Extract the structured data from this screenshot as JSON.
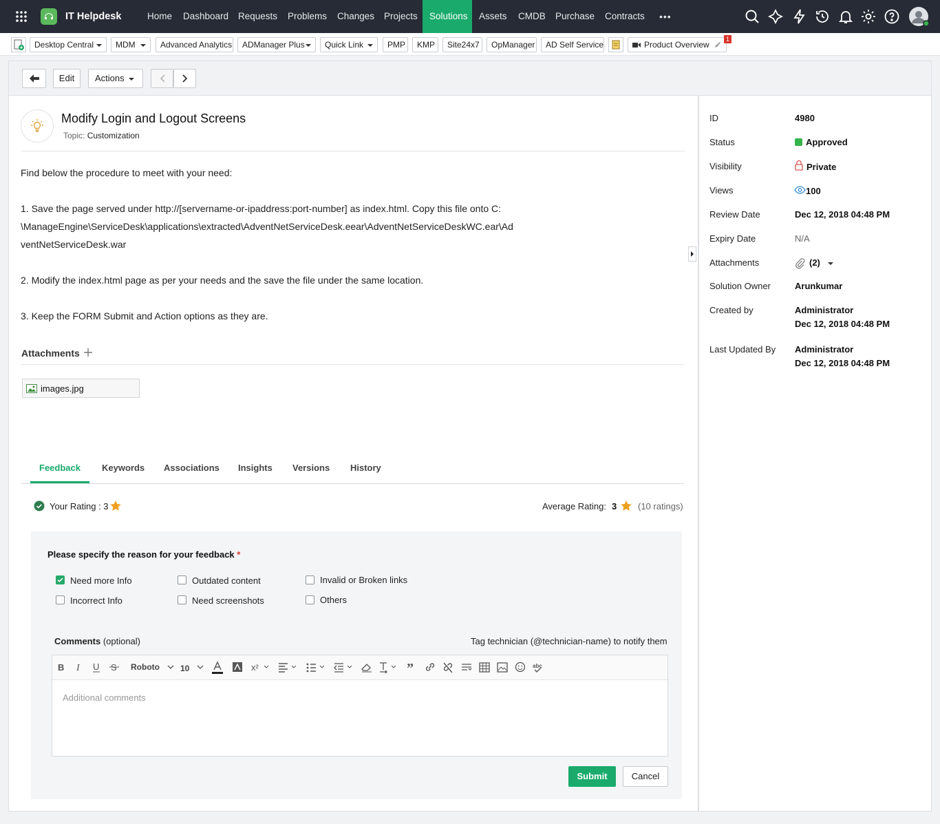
{
  "app": {
    "name": "IT Helpdesk"
  },
  "nav": {
    "items": [
      "Home",
      "Dashboard",
      "Requests",
      "Problems",
      "Changes",
      "Projects",
      "Solutions",
      "Assets",
      "CMDB",
      "Purchase",
      "Contracts"
    ],
    "more": "•••"
  },
  "quickbar": {
    "items": [
      "Desktop Central",
      "MDM",
      "Advanced Analytics",
      "ADManager Plus",
      "Quick Link",
      "PMP",
      "KMP",
      "Site24x7",
      "OpManager",
      "AD Self Service"
    ],
    "product_overview": "Product Overview",
    "badge": "1"
  },
  "toolbar": {
    "edit": "Edit",
    "actions": "Actions"
  },
  "solution": {
    "title": "Modify Login and Logout Screens",
    "topic_label": "Topic:",
    "topic": "Customization",
    "intro": "Find below the procedure to meet with your need:",
    "step1_line1": "1. Save the page served under http://[servername-or-ipaddress:port-number] as index.html. Copy this file onto C:",
    "step1_line2": "\\ManageEngine\\ServiceDesk\\applications\\extracted\\AdventNetServiceDesk.eear\\AdventNetServiceDeskWC.ear\\Ad",
    "step1_line3": "ventNetServiceDesk.war",
    "step2": "2. Modify the index.html page as per your needs and the save the file under the same location.",
    "step3": "3. Keep the FORM Submit and Action options as they are."
  },
  "attachments": {
    "label": "Attachments",
    "files": [
      "images.jpg"
    ]
  },
  "tabs": [
    "Feedback",
    "Keywords",
    "Associations",
    "Insights",
    "Versions",
    "History"
  ],
  "rating": {
    "your_label": "Your Rating : 3",
    "avg_label": "Average Rating:",
    "avg_value": "3",
    "count": "(10 ratings)"
  },
  "feedback": {
    "question": "Please specify the reason for your feedback",
    "required_mark": "*",
    "options": [
      {
        "label": "Need more Info",
        "checked": true
      },
      {
        "label": "Outdated content",
        "checked": false
      },
      {
        "label": "Invalid or Broken links",
        "checked": false
      },
      {
        "label": "Incorrect Info",
        "checked": false
      },
      {
        "label": "Need screenshots",
        "checked": false
      },
      {
        "label": "Others",
        "checked": false
      }
    ],
    "comments_label": "Comments",
    "comments_optional": "(optional)",
    "tag_hint": "Tag technician (@technician-name) to notify them",
    "font": "Roboto",
    "size": "10",
    "placeholder": "Additional comments",
    "submit": "Submit",
    "cancel": "Cancel"
  },
  "details": [
    {
      "label": "ID",
      "value": "4980"
    },
    {
      "label": "Status",
      "value": "Approved"
    },
    {
      "label": "Visibility",
      "value": "Private"
    },
    {
      "label": "Views",
      "value": "100"
    },
    {
      "label": "Review Date",
      "value": "Dec 12, 2018 04:48 PM"
    },
    {
      "label": "Expiry Date",
      "value": "N/A"
    },
    {
      "label": "Attachments",
      "value": "(2)"
    },
    {
      "label": "Solution Owner",
      "value": "Arunkumar"
    },
    {
      "label": "Created by",
      "value": "Administrator",
      "value2": "Dec 12, 2018 04:48 PM"
    },
    {
      "label": "Last Updated By",
      "value": "Administrator",
      "value2": "Dec 12, 2018 04:48 PM"
    }
  ],
  "colors": {
    "accent": "#1aab6c",
    "nav_bg": "#262b35",
    "star": "#f0a020",
    "status_green": "#35b44a"
  }
}
